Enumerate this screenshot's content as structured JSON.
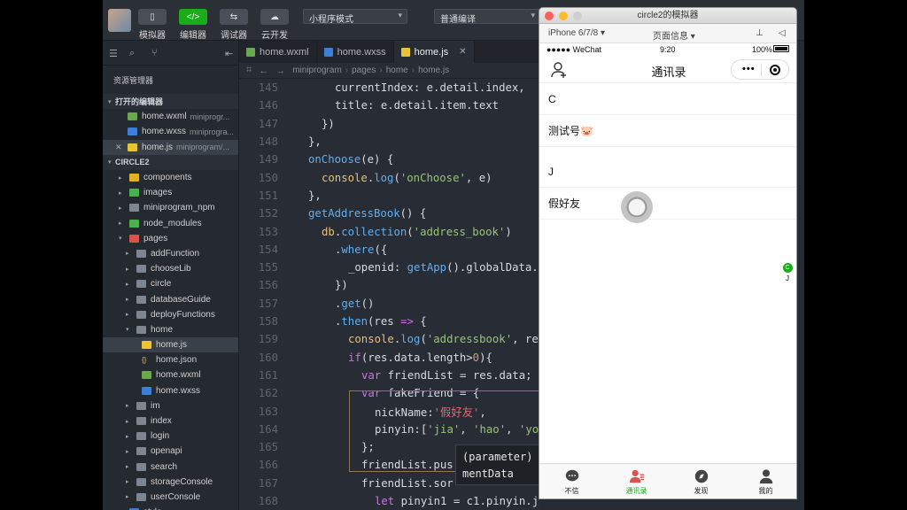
{
  "toolbar": {
    "buttons": [
      {
        "label": "模拟器",
        "glyph": "▯"
      },
      {
        "label": "编辑器",
        "glyph": "</>"
      },
      {
        "label": "调试器",
        "glyph": "⇆"
      },
      {
        "label": "云开发",
        "glyph": "☁"
      }
    ],
    "mode_select": "小程序模式",
    "compile_select": "普通编译"
  },
  "sidebar": {
    "title": "资源管理器",
    "open_editors_label": "打开的编辑器",
    "open_editors": [
      {
        "name": "home.wxml",
        "path": "miniprogr..."
      },
      {
        "name": "home.wxss",
        "path": "miniprogra..."
      },
      {
        "name": "home.js",
        "path": "miniprogram/..."
      }
    ],
    "project_label": "CIRCLE2",
    "tree": [
      {
        "name": "components",
        "indent": 1,
        "icon": "yellow"
      },
      {
        "name": "images",
        "indent": 1,
        "icon": "green"
      },
      {
        "name": "miniprogram_npm",
        "indent": 1,
        "icon": "grey"
      },
      {
        "name": "node_modules",
        "indent": 1,
        "icon": "green"
      },
      {
        "name": "pages",
        "indent": 1,
        "icon": "red",
        "open": true
      },
      {
        "name": "addFunction",
        "indent": 2,
        "icon": "grey"
      },
      {
        "name": "chooseLib",
        "indent": 2,
        "icon": "grey"
      },
      {
        "name": "circle",
        "indent": 2,
        "icon": "grey"
      },
      {
        "name": "databaseGuide",
        "indent": 2,
        "icon": "grey"
      },
      {
        "name": "deployFunctions",
        "indent": 2,
        "icon": "grey"
      },
      {
        "name": "home",
        "indent": 2,
        "icon": "grey",
        "open": true
      },
      {
        "name": "home.js",
        "indent": 3,
        "icon": "js",
        "active": true
      },
      {
        "name": "home.json",
        "indent": 3,
        "icon": "json"
      },
      {
        "name": "home.wxml",
        "indent": 3,
        "icon": "wxml"
      },
      {
        "name": "home.wxss",
        "indent": 3,
        "icon": "wxss"
      },
      {
        "name": "im",
        "indent": 2,
        "icon": "grey"
      },
      {
        "name": "index",
        "indent": 2,
        "icon": "grey"
      },
      {
        "name": "login",
        "indent": 2,
        "icon": "grey"
      },
      {
        "name": "openapi",
        "indent": 2,
        "icon": "grey"
      },
      {
        "name": "search",
        "indent": 2,
        "icon": "grey"
      },
      {
        "name": "storageConsole",
        "indent": 2,
        "icon": "grey"
      },
      {
        "name": "userConsole",
        "indent": 2,
        "icon": "grey"
      },
      {
        "name": "style",
        "indent": 1,
        "icon": "blue"
      }
    ]
  },
  "editor": {
    "tabs": [
      "home.wxml",
      "home.wxss",
      "home.js"
    ],
    "breadcrumb": [
      "miniprogram",
      "pages",
      "home",
      "home.js"
    ],
    "lines": [
      {
        "n": "145",
        "indent": 2,
        "tokens": [
          [
            "p",
            "currentIndex: e.detail.index,"
          ]
        ]
      },
      {
        "n": "146",
        "indent": 2,
        "tokens": [
          [
            "p",
            "title: e.detail.item.text"
          ]
        ]
      },
      {
        "n": "147",
        "indent": 1,
        "tokens": [
          [
            "p",
            "})"
          ]
        ]
      },
      {
        "n": "148",
        "indent": 0,
        "tokens": [
          [
            "p",
            "},"
          ]
        ]
      },
      {
        "n": "149",
        "indent": 0,
        "tokens": [
          [
            "f",
            "onChoose"
          ],
          [
            "p",
            "(e) {"
          ]
        ]
      },
      {
        "n": "150",
        "indent": 1,
        "tokens": [
          [
            "v",
            "console"
          ],
          [
            "p",
            "."
          ],
          [
            "f",
            "log"
          ],
          [
            "p",
            "("
          ],
          [
            "s",
            "'onChoose'"
          ],
          [
            "p",
            ", e)"
          ]
        ]
      },
      {
        "n": "151",
        "indent": 0,
        "tokens": [
          [
            "p",
            "},"
          ]
        ]
      },
      {
        "n": "152",
        "indent": 0,
        "tokens": [
          [
            "f",
            "getAddressBook"
          ],
          [
            "p",
            "() {"
          ]
        ]
      },
      {
        "n": "153",
        "indent": 1,
        "tokens": [
          [
            "v",
            "db"
          ],
          [
            "p",
            "."
          ],
          [
            "f",
            "collection"
          ],
          [
            "p",
            "("
          ],
          [
            "s",
            "'address_book'"
          ],
          [
            "p",
            ")"
          ]
        ]
      },
      {
        "n": "154",
        "indent": 2,
        "tokens": [
          [
            "p",
            "."
          ],
          [
            "f",
            "where"
          ],
          [
            "p",
            "({"
          ]
        ]
      },
      {
        "n": "155",
        "indent": 3,
        "tokens": [
          [
            "p",
            "_openid: "
          ],
          [
            "f",
            "getApp"
          ],
          [
            "p",
            "().globalData."
          ]
        ]
      },
      {
        "n": "156",
        "indent": 2,
        "tokens": [
          [
            "p",
            "})"
          ]
        ]
      },
      {
        "n": "157",
        "indent": 2,
        "tokens": [
          [
            "p",
            "."
          ],
          [
            "f",
            "get"
          ],
          [
            "p",
            "()"
          ]
        ]
      },
      {
        "n": "158",
        "indent": 2,
        "tokens": [
          [
            "p",
            "."
          ],
          [
            "f",
            "then"
          ],
          [
            "p",
            "(res "
          ],
          [
            "k",
            "=>"
          ],
          [
            "p",
            " {"
          ]
        ]
      },
      {
        "n": "159",
        "indent": 3,
        "tokens": [
          [
            "v",
            "console"
          ],
          [
            "p",
            "."
          ],
          [
            "f",
            "log"
          ],
          [
            "p",
            "("
          ],
          [
            "s",
            "'addressbook'"
          ],
          [
            "p",
            ", re"
          ]
        ]
      },
      {
        "n": "160",
        "indent": 3,
        "tokens": [
          [
            "k",
            "if"
          ],
          [
            "p",
            "(res.data.length>"
          ],
          [
            "n",
            "0"
          ],
          [
            "p",
            "){"
          ]
        ]
      },
      {
        "n": "161",
        "indent": 4,
        "tokens": [
          [
            "k",
            "var"
          ],
          [
            "p",
            " friendList = res.data;"
          ]
        ]
      },
      {
        "n": "162",
        "indent": 4,
        "tokens": [
          [
            "k",
            "var"
          ],
          [
            "p",
            " fakeFriend = {"
          ]
        ]
      },
      {
        "n": "163",
        "indent": 5,
        "tokens": [
          [
            "p",
            "nickName:"
          ],
          [
            "r",
            "'假好友'"
          ],
          [
            "p",
            ","
          ]
        ]
      },
      {
        "n": "164",
        "indent": 5,
        "tokens": [
          [
            "p",
            "pinyin:["
          ],
          [
            "s",
            "'jia'"
          ],
          [
            "p",
            ", "
          ],
          [
            "s",
            "'hao'"
          ],
          [
            "p",
            ", "
          ],
          [
            "s",
            "'yo"
          ]
        ]
      },
      {
        "n": "165",
        "indent": 4,
        "tokens": [
          [
            "p",
            "};"
          ]
        ]
      },
      {
        "n": "166",
        "indent": 4,
        "tokens": [
          [
            "p",
            "friendList.pus"
          ]
        ]
      },
      {
        "n": "167",
        "indent": 4,
        "tokens": [
          [
            "p",
            "friendList.sor"
          ]
        ]
      },
      {
        "n": "168",
        "indent": 5,
        "tokens": [
          [
            "k",
            "let"
          ],
          [
            "p",
            " pinyin1 = c1.pinyin.j"
          ]
        ]
      }
    ],
    "tooltip_line1": "(parameter)",
    "tooltip_line2": "mentData"
  },
  "simulator": {
    "window_title": "circle2的模拟器",
    "device": "iPhone 6/7/8",
    "page_info": "页面信息",
    "carrier": "●●●●● WeChat",
    "time": "9:20",
    "battery": "100%",
    "nav_title": "通讯录",
    "contacts": [
      {
        "text": "C",
        "type": "header"
      },
      {
        "text": "测试号🐷",
        "type": "item"
      },
      {
        "text": "J",
        "type": "header"
      },
      {
        "text": "假好友",
        "type": "item"
      }
    ],
    "index_letters": [
      "C",
      "J"
    ],
    "tabbar": [
      {
        "label": "不信",
        "icon": "chat-icon"
      },
      {
        "label": "通讯录",
        "icon": "contacts-icon",
        "active": true
      },
      {
        "label": "发现",
        "icon": "compass-icon"
      },
      {
        "label": "我的",
        "icon": "person-icon"
      }
    ],
    "accent_color": "#1aad19"
  }
}
